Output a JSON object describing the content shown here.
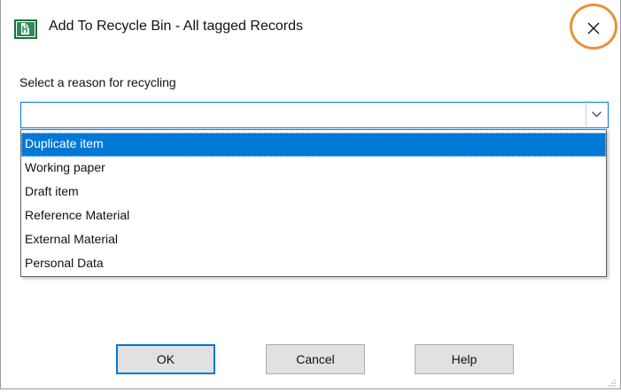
{
  "window": {
    "title": "Add To Recycle Bin - All tagged Records",
    "app_icon": "app-document-icon",
    "close_icon": "close-icon",
    "highlight_color": "#e8913b"
  },
  "form": {
    "reason_label": "Select a reason for recycling",
    "reason_value": "",
    "options": [
      "Duplicate item",
      "Working paper",
      "Draft item",
      "Reference Material",
      "External Material",
      "Personal Data"
    ],
    "selected_option": "Duplicate item"
  },
  "buttons": {
    "ok": "OK",
    "cancel": "Cancel",
    "help": "Help"
  },
  "colors": {
    "accent": "#0078d7",
    "button_bg": "#e1e1e1"
  }
}
